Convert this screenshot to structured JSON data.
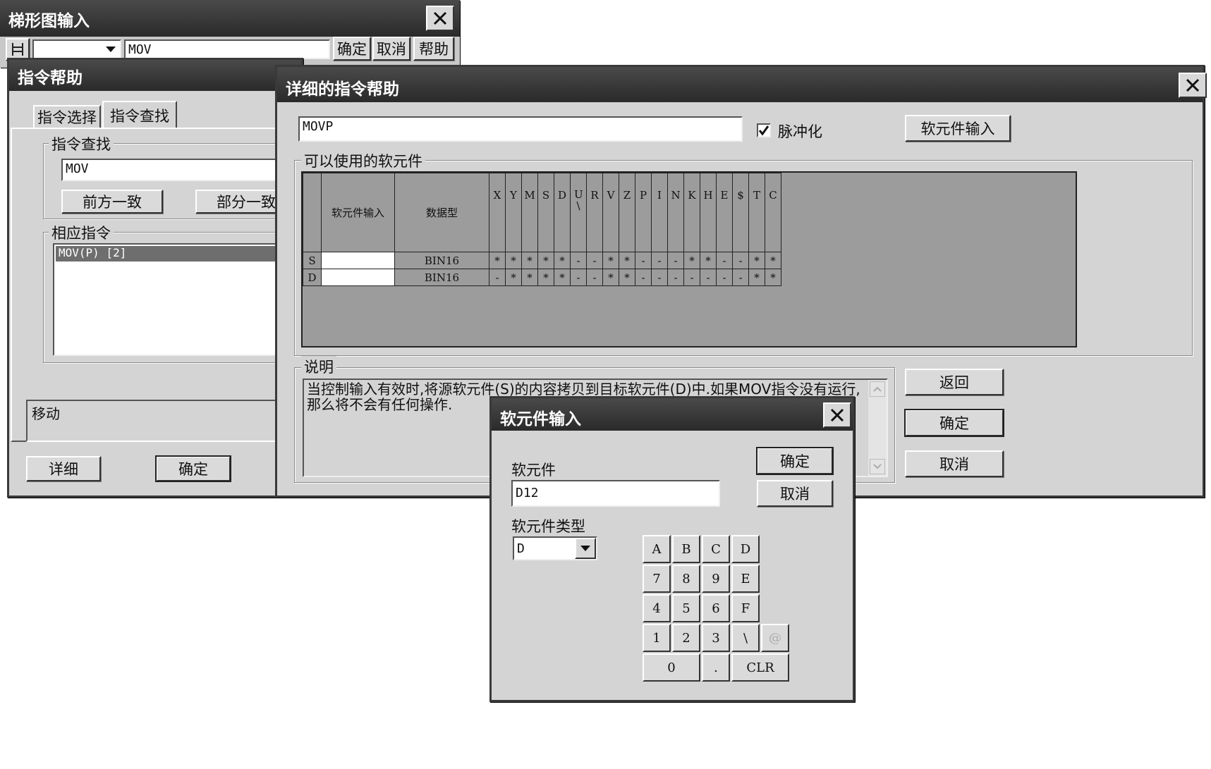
{
  "ladder_input": {
    "title": "梯形图输入",
    "combo_value": "",
    "instruction_value": "MOV",
    "ok": "确定",
    "cancel": "取消",
    "help": "帮助"
  },
  "instr_help": {
    "title": "指令帮助",
    "tabs": [
      "指令选择",
      "指令查找"
    ],
    "search_group": "指令查找",
    "search_value": "MOV",
    "prefix_match": "前方一致",
    "partial_match": "部分一致",
    "matches_group": "相应指令",
    "matches": [
      "MOV(P) [2]"
    ],
    "description": "移动",
    "detail": "详细",
    "ok": "确定"
  },
  "detail_help": {
    "title": "详细的指令帮助",
    "instruction": "MOVP",
    "pulse_label": "脉冲化",
    "pulse_checked": true,
    "device_input_button": "软元件输入",
    "devices_group": "可以使用的软元件",
    "table": {
      "col_input": "软元件输入",
      "col_type": "数据型",
      "device_cols": [
        "X",
        "Y",
        "M",
        "S",
        "D",
        "U\\",
        "R",
        "V",
        "Z",
        "P",
        "I",
        "N",
        "K",
        "H",
        "E",
        "$",
        "T",
        "C"
      ],
      "rows": [
        {
          "operand": "S",
          "input": "",
          "type": "BIN16",
          "marks": [
            "*",
            "*",
            "*",
            "*",
            "*",
            "-",
            "-",
            "*",
            "*",
            "-",
            "-",
            "-",
            "*",
            "*",
            "-",
            "-",
            "*",
            "*"
          ]
        },
        {
          "operand": "D",
          "input": "",
          "type": "BIN16",
          "marks": [
            "-",
            "*",
            "*",
            "*",
            "*",
            "-",
            "-",
            "*",
            "*",
            "-",
            "-",
            "-",
            "-",
            "-",
            "-",
            "-",
            "*",
            "*"
          ]
        }
      ]
    },
    "explain_group": "说明",
    "explain_text": "当控制输入有效时,将源软元件(S)的内容拷贝到目标软元件(D)中.如果MOV指令没有运行,那么将不会有任何操作.",
    "back": "返回",
    "ok": "确定",
    "cancel": "取消"
  },
  "device_input": {
    "title": "软元件输入",
    "device_label": "软元件",
    "device_value": "D12",
    "type_label": "软元件类型",
    "type_value": "D",
    "ok": "确定",
    "cancel": "取消",
    "keys": [
      "A",
      "B",
      "C",
      "D",
      "7",
      "8",
      "9",
      "E",
      "4",
      "5",
      "6",
      "F",
      "1",
      "2",
      "3",
      "\\",
      "@",
      "0",
      ".",
      "CLR"
    ]
  }
}
